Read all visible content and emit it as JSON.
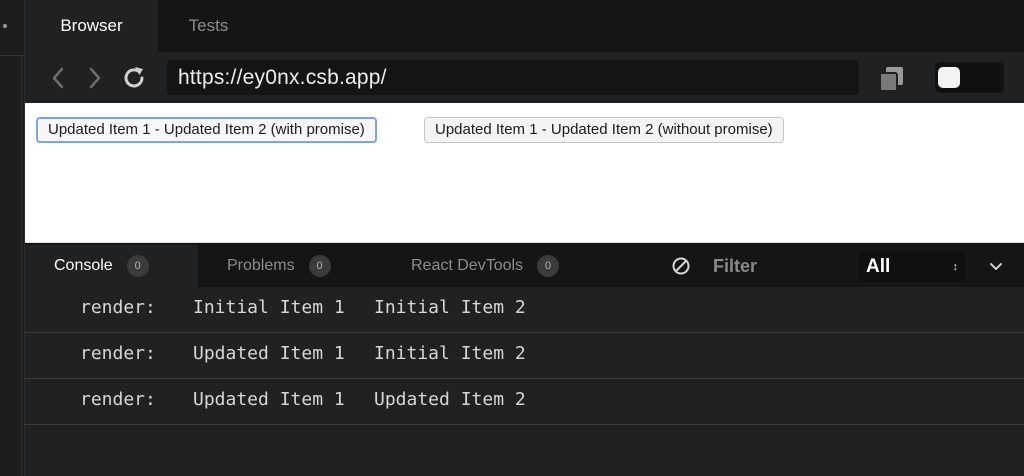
{
  "tabs": [
    {
      "label": "Browser",
      "active": true
    },
    {
      "label": "Tests",
      "active": false
    }
  ],
  "navigation": {
    "url": "https://ey0nx.csb.app/",
    "icons": [
      "back-arrow-icon",
      "forward-arrow-icon",
      "reload-icon",
      "copy-icon"
    ]
  },
  "preview": {
    "buttons": [
      {
        "label": "Updated Item 1 - Updated Item 2 (with promise)",
        "focused": true
      },
      {
        "label": "Updated Item 1 - Updated Item 2 (without promise)",
        "focused": false
      }
    ]
  },
  "console_tabs": [
    {
      "label": "Console",
      "count": "0",
      "active": true
    },
    {
      "label": "Problems",
      "count": "0",
      "active": false
    },
    {
      "label": "React DevTools",
      "count": "0",
      "active": false
    }
  ],
  "filter": {
    "label": "Filter",
    "level": "All",
    "icons": [
      "clear-icon",
      "chevron-down-icon"
    ]
  },
  "console_rows": [
    {
      "key": "render:",
      "item1": "Initial Item 1",
      "item2": "Initial Item 2"
    },
    {
      "key": "render:",
      "item1": "Updated Item 1",
      "item2": "Initial Item 2"
    },
    {
      "key": "render:",
      "item1": "Updated Item 1",
      "item2": "Updated Item 2"
    }
  ],
  "colors": {
    "background": "#151515",
    "panel": "#202122",
    "focus_ring": "#7ba4e7"
  }
}
